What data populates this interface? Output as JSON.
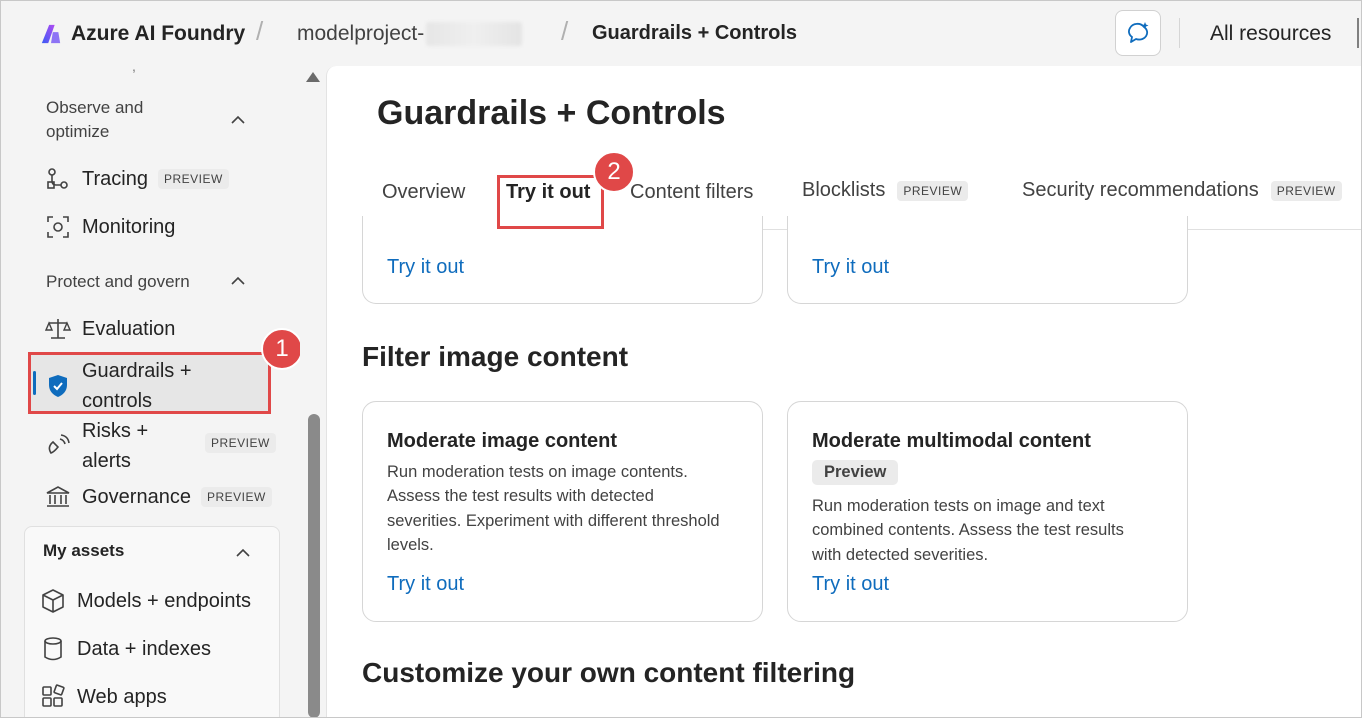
{
  "topbar": {
    "brand": "Azure AI Foundry",
    "separator": "/",
    "project": "modelproject-",
    "current_page": "Guardrails + Controls",
    "all_resources": "All resources"
  },
  "sidebar": {
    "observe_group": "Observe and optimize",
    "tracing": {
      "label": "Tracing",
      "badge": "PREVIEW"
    },
    "monitoring": {
      "label": "Monitoring"
    },
    "protect_group": "Protect and govern",
    "evaluation": {
      "label": "Evaluation"
    },
    "guardrails": {
      "label_line1": "Guardrails +",
      "label_line2": "controls"
    },
    "risks": {
      "label_line1": "Risks +",
      "label_line2": "alerts",
      "badge": "PREVIEW"
    },
    "governance": {
      "label": "Governance",
      "badge": "PREVIEW"
    },
    "assets": {
      "title": "My assets",
      "items": [
        "Models + endpoints",
        "Data + indexes",
        "Web apps"
      ]
    }
  },
  "annotations": {
    "step1": "1",
    "step2": "2"
  },
  "main": {
    "title": "Guardrails + Controls",
    "tabs": {
      "overview": "Overview",
      "try_it_out": "Try it out",
      "content_filters": "Content filters",
      "blocklists": "Blocklists",
      "blocklists_badge": "PREVIEW",
      "security": "Security recommendations",
      "security_badge": "PREVIEW"
    },
    "top_cards": {
      "link_left": "Try it out",
      "link_right": "Try it out"
    },
    "image_section": {
      "title": "Filter image content",
      "card1": {
        "title": "Moderate image content",
        "desc": "Run moderation tests on image contents. Assess the test results with detected severities. Experiment with different threshold levels.",
        "link": "Try it out"
      },
      "card2": {
        "title": "Moderate multimodal content",
        "pill": "Preview",
        "desc": "Run moderation tests on image and text combined contents. Assess the test results with detected severities.",
        "link": "Try it out"
      }
    },
    "custom_section": {
      "title": "Customize your own content filtering"
    }
  },
  "colors": {
    "accent": "#0f6cbd",
    "annotation": "#e04848",
    "background": "#f4f4f4"
  }
}
